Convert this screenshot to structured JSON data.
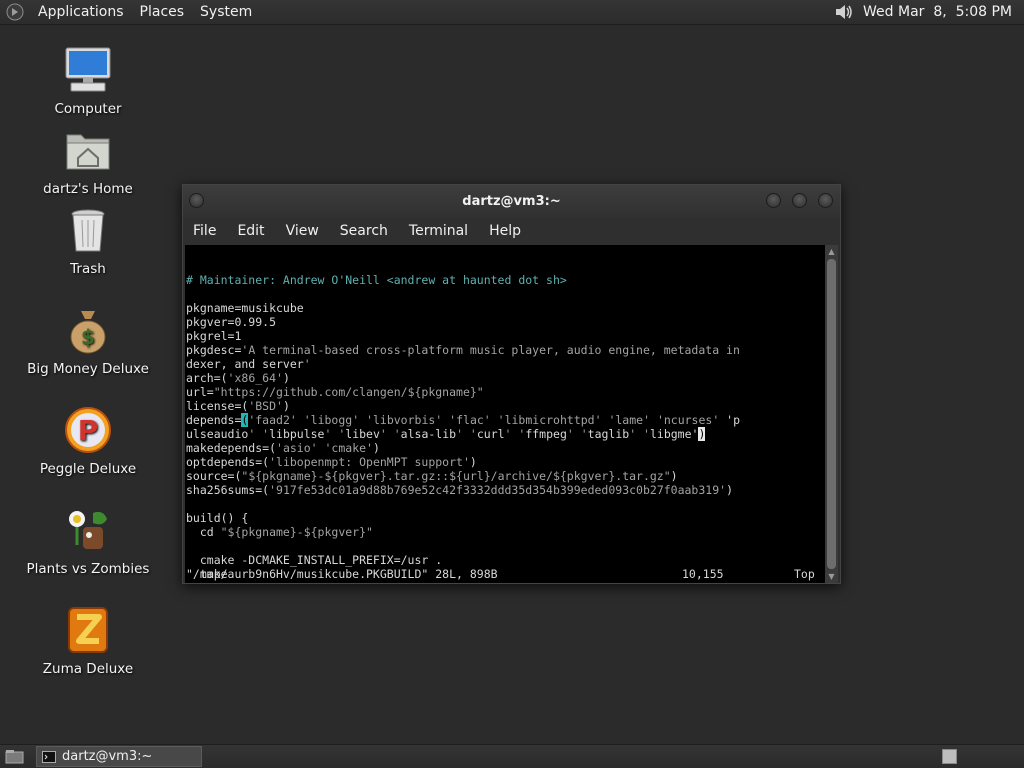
{
  "top_panel": {
    "menus": [
      "Applications",
      "Places",
      "System"
    ],
    "clock": "Wed Mar  8,  5:08 PM",
    "icons": [
      "gnome-foot-icon",
      "volume-icon"
    ]
  },
  "desktop_icons": [
    {
      "label": "Computer",
      "icon": "computer-icon"
    },
    {
      "label": "dartz's Home",
      "icon": "home-folder-icon"
    },
    {
      "label": "Trash",
      "icon": "trash-icon"
    },
    {
      "label": "Big Money Deluxe",
      "icon": "money-bag-icon"
    },
    {
      "label": "Peggle Deluxe",
      "icon": "peggle-icon"
    },
    {
      "label": "Plants vs Zombies",
      "icon": "plants-vs-zombies-icon"
    },
    {
      "label": "Zuma Deluxe",
      "icon": "zuma-icon"
    }
  ],
  "terminal": {
    "title": "dartz@vm3:~",
    "menu": [
      "File",
      "Edit",
      "View",
      "Search",
      "Terminal",
      "Help"
    ],
    "lines": [
      "# Maintainer: Andrew O'Neill <andrew at haunted dot sh>",
      "",
      "pkgname=musikcube",
      "pkgver=0.99.5",
      "pkgrel=1",
      "pkgdesc='A terminal-based cross-platform music player, audio engine, metadata in",
      "dexer, and server'",
      "arch=('x86_64')",
      "url=\"https://github.com/clangen/${pkgname}\"",
      "license=('BSD')",
      "depends=('faad2' 'libogg' 'libvorbis' 'flac' 'libmicrohttpd' 'lame' 'ncurses' 'p",
      "ulseaudio' 'libpulse' 'libev' 'alsa-lib' 'curl' 'ffmpeg' 'taglib' 'libgme')",
      "makedepends=('asio' 'cmake')",
      "optdepends=('libopenmpt: OpenMPT support')",
      "source=(\"${pkgname}-${pkgver}.tar.gz::${url}/archive/${pkgver}.tar.gz\")",
      "sha256sums=('917fe53dc01a9d88b769e52c42f3332ddd35d354b399eded093c0b27f0aab319')",
      "",
      "build() {",
      "  cd \"${pkgname}-${pkgver}\"",
      "",
      "  cmake -DCMAKE_INSTALL_PREFIX=/usr .",
      "  make",
      "}"
    ],
    "status_file": "\"/tmp/aurb9n6Hv/musikcube.PKGBUILD\" 28L, 898B",
    "status_pos": "10,155",
    "status_scroll": "Top"
  },
  "bottom_panel": {
    "task": "dartz@vm3:~"
  },
  "colors": {
    "desktop_bg": "#2a2b2a",
    "comment": "#5fb0b0",
    "string": "#a3a3a3",
    "cursor": "#22b5b5"
  }
}
